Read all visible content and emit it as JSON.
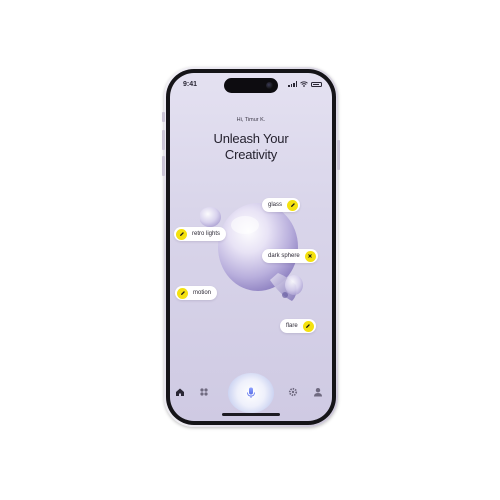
{
  "status_bar": {
    "time": "9:41"
  },
  "header": {
    "greeting": "Hi, Timur K.",
    "title_line1": "Unleash Your",
    "title_line2": "Creativity"
  },
  "tags": [
    {
      "label": "glass",
      "icon": "pencil-icon"
    },
    {
      "label": "retro lights",
      "icon": "pencil-icon"
    },
    {
      "label": "dark sphere",
      "icon": "close-icon"
    },
    {
      "label": "motion",
      "icon": "pencil-icon"
    },
    {
      "label": "flare",
      "icon": "pencil-icon"
    }
  ],
  "nav": {
    "items": [
      "home-icon",
      "grid-icon",
      "microphone-icon",
      "gear-icon",
      "profile-icon"
    ]
  },
  "colors": {
    "accent": "#f4e10f",
    "text": "#24212e",
    "screen_bg": "#dcd8ec"
  }
}
